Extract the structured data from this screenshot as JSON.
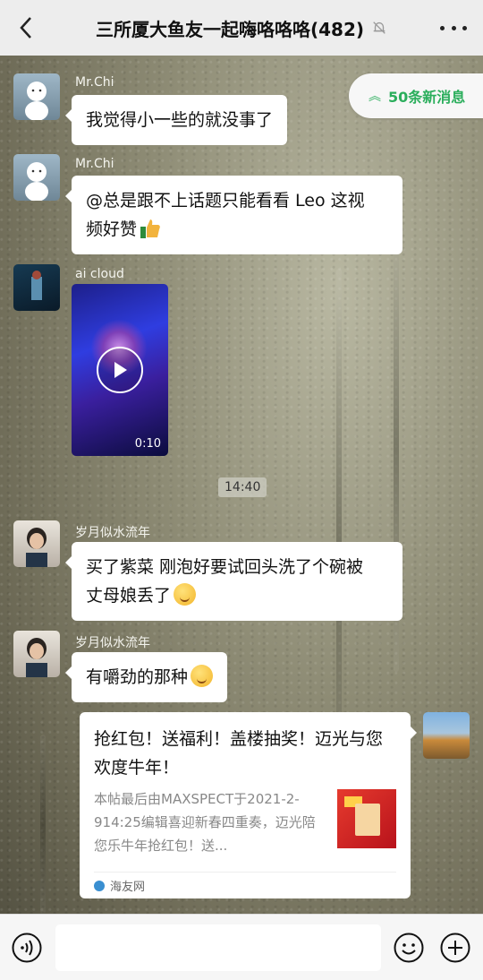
{
  "header": {
    "title": "三所厦大鱼友一起嗨咯咯咯(482)",
    "back_icon": "chevron-left-icon",
    "mute_icon": "bell-off-icon",
    "more_icon": "more-dots-icon"
  },
  "new_messages": {
    "label": "50条新消息",
    "icon": "double-chevron-up-icon",
    "color": "#2bae5c"
  },
  "messages": [
    {
      "sender": "Mr.Chi",
      "text": "我觉得小一些的就没事了"
    },
    {
      "sender": "Mr.Chi",
      "text_line1": "@总是跟不上话题只能看看 Leo  这视",
      "text_line2": "频好赞",
      "emoji": "thumbs-up-icon"
    },
    {
      "sender": "ai cloud",
      "video_duration": "0:10",
      "video_icon": "play-icon"
    },
    {
      "time": "14:40"
    },
    {
      "sender": "岁月似水流年",
      "text_line1": "买了紫菜 刚泡好要试回头洗了个碗被",
      "text_line2": "丈母娘丢了",
      "emoji": "smile-emoji-icon"
    },
    {
      "sender": "岁月似水流年",
      "text": "有嚼劲的那种",
      "emoji": "smile-emoji-icon"
    }
  ],
  "link_card": {
    "title": "抢红包！送福利！盖楼抽奖！迈光与您欢度牛年！",
    "description": "本帖最后由MAXSPECT于2021-2-914:25编辑喜迎新春四重奏，迈光陪您乐牛年抢红包！送...",
    "source": "海友网"
  },
  "composer": {
    "input_value": "",
    "voice_icon": "voice-icon",
    "emoji_icon": "emoji-face-icon",
    "plus_icon": "plus-circle-icon"
  }
}
